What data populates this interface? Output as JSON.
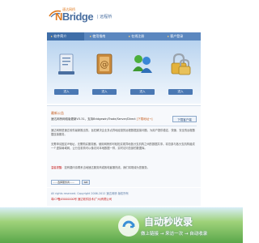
{
  "header": {
    "logo_small": "速达网桥",
    "logo_brand_n": "N",
    "logo_brand_rest": "Bridge",
    "logo_sub": "| 远程桥"
  },
  "nav": {
    "tabs": [
      {
        "label": "软件简介"
      },
      {
        "label": "使用指南"
      },
      {
        "label": "在线注册"
      },
      {
        "label": "客户登录"
      }
    ]
  },
  "tiles": [
    {
      "icon": "document-icon",
      "button": "进入"
    },
    {
      "icon": "address-book-icon",
      "button": "进入"
    },
    {
      "icon": "users-icon",
      "button": "进入"
    },
    {
      "icon": "lock-icon",
      "button": "进入"
    }
  ],
  "panel": {
    "title": "最新公告",
    "info_prefix": "速达网桥网络版更新V3.31，支持Bridgewin/Trade/Server/Direct ",
    "info_link": "[下载地址→]",
    "feedback_button": "下载客户端",
    "paragraphs": [
      "速达网桥是速达软件最新推出的，旨在解决企业多点异地经营的远程数据连接问题，为用户提供稳定、快速、安全的远程数据连接服务。",
      "无需申请固定IP地址，无需购买服务器，使用网桥即可轻松实现异地各分支机构之间的数据共享。将总部与各分支机构组成一个虚拟局域网，让分支机构可以像访问本地数据一样，实时访问总部的数据库。"
    ],
    "note_label": "温馨提醒：",
    "note_text": "如有疑问请联系当地速达服务商或致电客服热线，我们将竭诚为您服务。",
    "select_value": "——选择服务商——",
    "go_button": "GO"
  },
  "footer": {
    "line1": "All rights reserved. Copyright 2006-2012 速达网桥 版权所有",
    "line2": "粤ICP备05000000号 速达软件技术(广州)有限公司"
  },
  "watermark": {
    "main": "自动秒收录",
    "sub": "做上链接 → 来访一次 → 自动收录"
  }
}
